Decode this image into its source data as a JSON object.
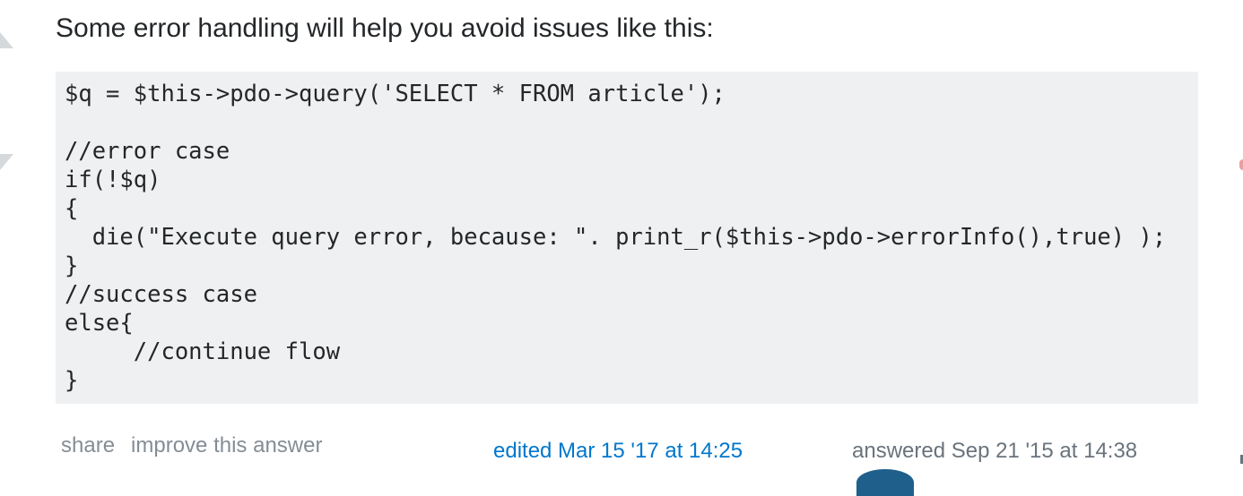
{
  "answer": {
    "intro_text": "Some error handling will help you avoid issues like this:",
    "code_lines": [
      "$q = $this->pdo->query('SELECT * FROM article');",
      "",
      "//error case",
      "if(!$q)",
      "{",
      "  die(\"Execute query error, because: \". print_r($this->pdo->errorInfo(),true) );",
      "}",
      "//success case",
      "else{",
      "     //continue flow",
      "}"
    ]
  },
  "post_menu": {
    "share_label": "share",
    "improve_label": "improve this answer"
  },
  "signature": {
    "edited_text": "edited Mar 15 '17 at 14:25",
    "answered_text": "answered Sep 21 '15 at 14:38"
  },
  "colors": {
    "code_background": "#eff0f1",
    "link_blue": "#0077cc",
    "muted_text": "#848d95"
  }
}
